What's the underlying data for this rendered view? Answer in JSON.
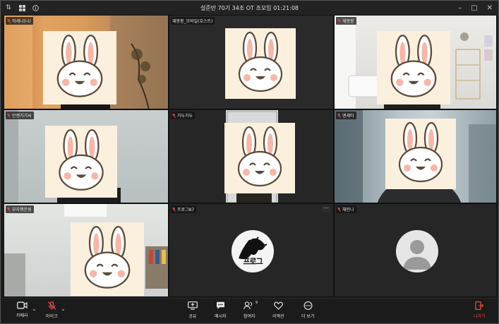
{
  "window": {
    "title": "설준반 70기 34조 OT 조모임 01:21:08"
  },
  "participants": [
    {
      "name": "허세나(나)",
      "scene": "warm-room"
    },
    {
      "name": "재봉봉_모바일(호스트)",
      "scene": "dark"
    },
    {
      "name": "재봉봉",
      "scene": "white-room"
    },
    {
      "name": "안젠가기씨",
      "scene": "light-wall"
    },
    {
      "name": "가두가두",
      "scene": "dark-door"
    },
    {
      "name": "엔세티",
      "scene": "office"
    },
    {
      "name": "부자행운됨",
      "scene": "living-room"
    },
    {
      "name": "프로그87",
      "scene": "logo",
      "logo_text": "프로그"
    },
    {
      "name": "채린나",
      "scene": "avatar"
    }
  ],
  "toolbar": {
    "camera_label": "카메라",
    "mic_label": "마이크",
    "share_label": "공유",
    "message_label": "메시지",
    "participants_label": "참여자",
    "participants_count": "9",
    "reaction_label": "리액션",
    "more_label": "더 보기",
    "leave_label": "나가기"
  },
  "colors": {
    "leave_red": "#e8503a",
    "mic_muted_red": "#e05050",
    "rabbit_bg": "#fbf0de"
  }
}
